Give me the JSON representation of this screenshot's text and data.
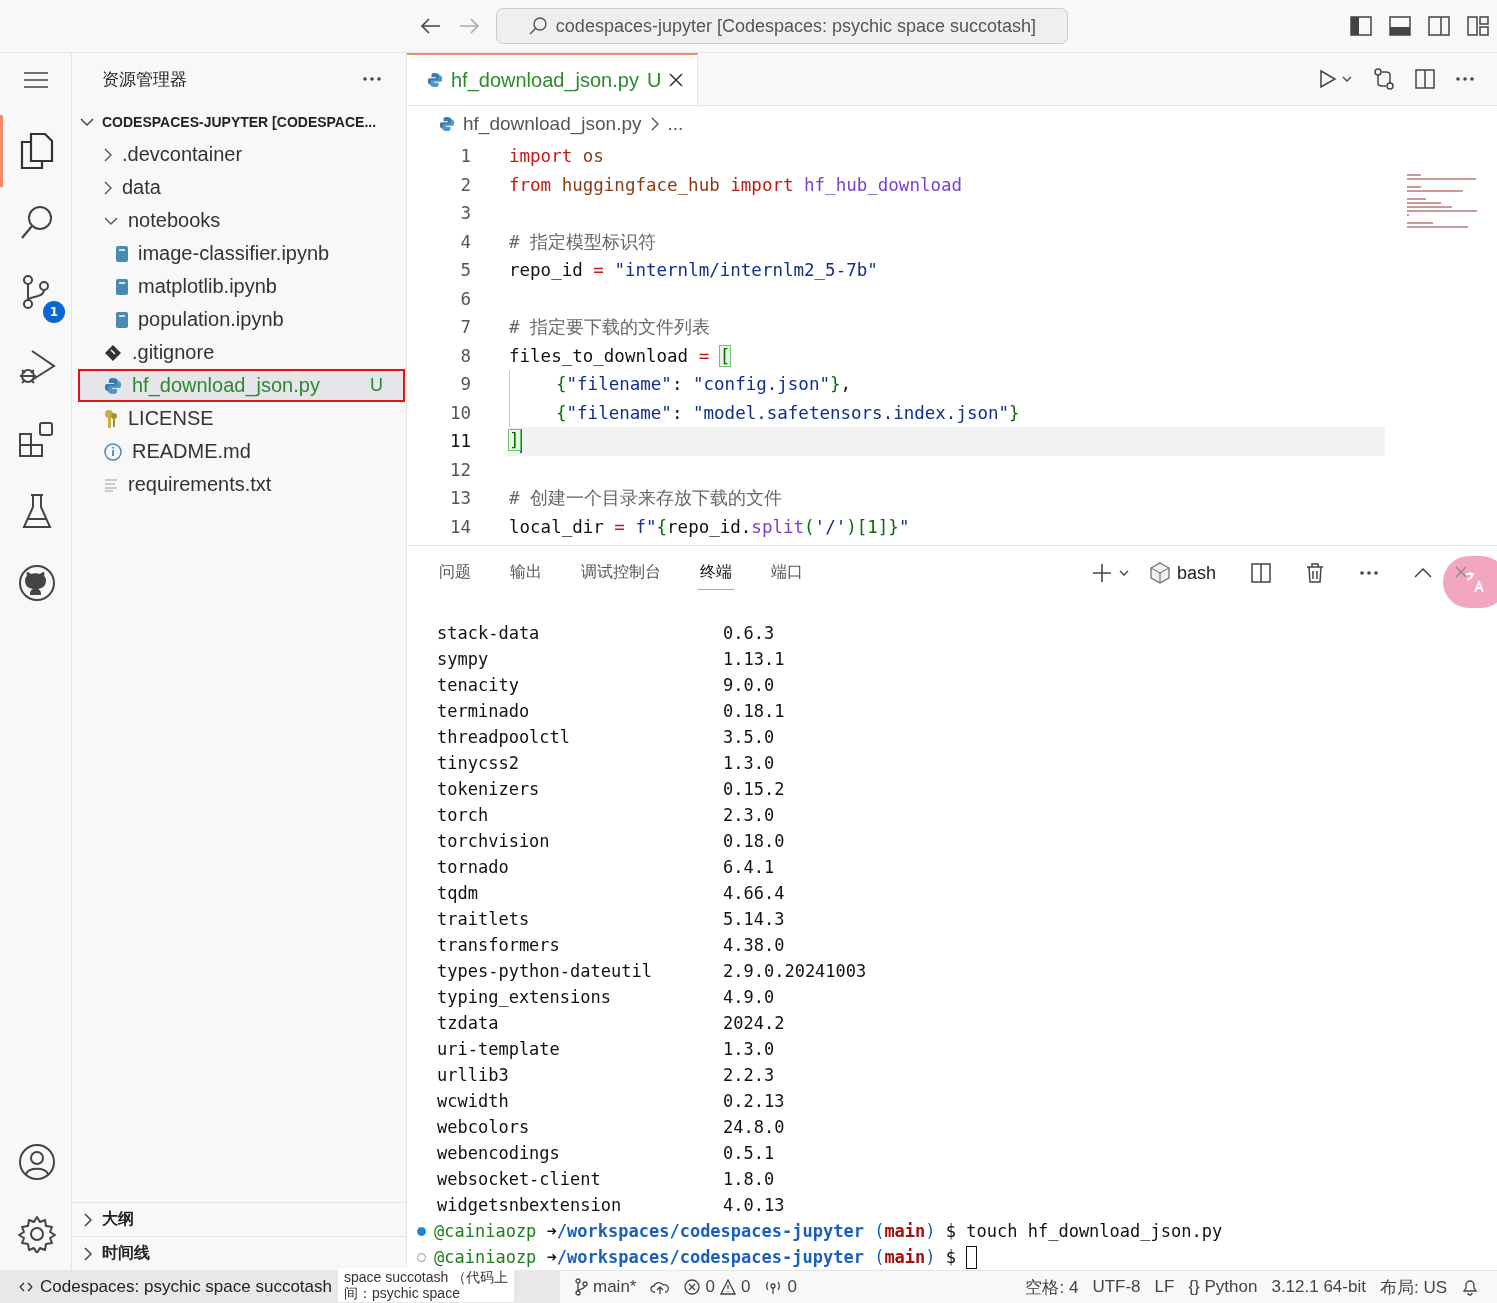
{
  "title_bar": {
    "search": "codespaces-jupyter [Codespaces: psychic space succotash]"
  },
  "activity_bar": {
    "items": [
      {
        "kind": "explorer",
        "selected": true
      },
      {
        "kind": "search",
        "selected": false
      },
      {
        "kind": "source-control",
        "selected": false,
        "badge": "1"
      },
      {
        "kind": "run-debug",
        "selected": false
      },
      {
        "kind": "extensions",
        "selected": false
      },
      {
        "kind": "testing",
        "selected": false
      },
      {
        "kind": "github",
        "selected": false
      }
    ],
    "bottom": [
      {
        "kind": "account"
      },
      {
        "kind": "settings"
      }
    ]
  },
  "sidebar": {
    "title": "资源管理器",
    "root": "CODESPACES-JUPYTER [CODESPACE...",
    "items": [
      {
        "label": ".devcontainer",
        "kind": "folder",
        "expanded": false,
        "selected": false
      },
      {
        "label": "data",
        "kind": "folder",
        "expanded": false,
        "selected": false
      },
      {
        "label": "notebooks",
        "kind": "folder",
        "expanded": true,
        "selected": false,
        "children": [
          {
            "label": "image-classifier.ipynb",
            "kind": "notebook",
            "selected": false
          },
          {
            "label": "matplotlib.ipynb",
            "kind": "notebook",
            "selected": false
          },
          {
            "label": "population.ipynb",
            "kind": "notebook",
            "selected": false
          }
        ]
      },
      {
        "label": ".gitignore",
        "kind": "git",
        "selected": false
      },
      {
        "label": "hf_download_json.py",
        "kind": "python",
        "selected": true,
        "highlighted": true,
        "status": "U"
      },
      {
        "label": "LICENSE",
        "kind": "license",
        "selected": false
      },
      {
        "label": "README.md",
        "kind": "info",
        "selected": false
      },
      {
        "label": "requirements.txt",
        "kind": "text",
        "selected": false
      }
    ],
    "sections": [
      {
        "label": "大纲",
        "expanded": false
      },
      {
        "label": "时间线",
        "expanded": false
      }
    ]
  },
  "editor": {
    "tabs": [
      {
        "label": "hf_download_json.py",
        "status": "U",
        "selected": true
      }
    ],
    "breadcrumb": [
      "hf_download_json.py",
      "..."
    ],
    "lines": [
      {
        "number": "1",
        "current": false,
        "indented": false,
        "tokens": [
          {
            "text": "import",
            "kind": "keyword"
          },
          {
            "text": " os",
            "kind": "module"
          }
        ]
      },
      {
        "number": "2",
        "current": false,
        "indented": false,
        "tokens": [
          {
            "text": "from",
            "kind": "keyword"
          },
          {
            "text": " huggingface_hub ",
            "kind": "module"
          },
          {
            "text": "import",
            "kind": "keyword"
          },
          {
            "text": " hf_hub_download",
            "kind": "function"
          }
        ]
      },
      {
        "number": "3",
        "current": false,
        "indented": false
      },
      {
        "number": "4",
        "current": false,
        "indented": false,
        "tokens": [
          {
            "text": "# 指定模型标识符",
            "kind": "comment"
          }
        ]
      },
      {
        "number": "5",
        "current": false,
        "indented": false,
        "tokens": [
          {
            "text": "repo_id ",
            "kind": "name"
          },
          {
            "text": "=",
            "kind": "operator"
          },
          {
            "text": " \"internlm/internlm2_5-7b\"",
            "kind": "string"
          }
        ]
      },
      {
        "number": "6",
        "current": false,
        "indented": false
      },
      {
        "number": "7",
        "current": false,
        "indented": false,
        "tokens": [
          {
            "text": "# 指定要下载的文件列表",
            "kind": "comment"
          }
        ]
      },
      {
        "number": "8",
        "current": false,
        "indented": false,
        "tokens": [
          {
            "text": "files_to_download ",
            "kind": "name"
          },
          {
            "text": "= ",
            "kind": "operator"
          },
          {
            "text": "[",
            "kind": "matched-bracket"
          }
        ]
      },
      {
        "number": "9",
        "current": false,
        "indented": true,
        "tokens": [
          {
            "text": "{",
            "kind": "bracket"
          },
          {
            "text": "\"filename\"",
            "kind": "string"
          },
          {
            "text": ": ",
            "kind": "name"
          },
          {
            "text": "\"config.json\"",
            "kind": "string"
          },
          {
            "text": "}",
            "kind": "bracket"
          },
          {
            "text": ",",
            "kind": "name"
          }
        ]
      },
      {
        "number": "10",
        "current": false,
        "indented": true,
        "tokens": [
          {
            "text": "{",
            "kind": "bracket"
          },
          {
            "text": "\"filename\"",
            "kind": "string"
          },
          {
            "text": ": ",
            "kind": "name"
          },
          {
            "text": "\"model.safetensors.index.json\"",
            "kind": "string"
          },
          {
            "text": "}",
            "kind": "bracket"
          }
        ]
      },
      {
        "number": "11",
        "current": true,
        "indented": false,
        "tokens": [
          {
            "text": "]",
            "kind": "matched-bracket"
          }
        ]
      },
      {
        "number": "12",
        "current": false,
        "indented": false
      },
      {
        "number": "13",
        "current": false,
        "indented": false,
        "tokens": [
          {
            "text": "# 创建一个目录来存放下载的文件",
            "kind": "comment"
          }
        ]
      },
      {
        "number": "14",
        "current": false,
        "indented": false,
        "tokens": [
          {
            "text": "local_dir ",
            "kind": "name"
          },
          {
            "text": "=",
            "kind": "operator"
          },
          {
            "text": " f\"",
            "kind": "string"
          },
          {
            "text": "{",
            "kind": "bracket"
          },
          {
            "text": "repo_id.",
            "kind": "name"
          },
          {
            "text": "split",
            "kind": "function"
          },
          {
            "text": "(",
            "kind": "bracket"
          },
          {
            "text": "'/'",
            "kind": "string"
          },
          {
            "text": ")[1]",
            "kind": "bracket"
          },
          {
            "text": "}",
            "kind": "bracket"
          },
          {
            "text": "\"",
            "kind": "string"
          }
        ]
      }
    ]
  },
  "panel": {
    "tabs": [
      {
        "label": "问题",
        "selected": false
      },
      {
        "label": "输出",
        "selected": false
      },
      {
        "label": "调试控制台",
        "selected": false
      },
      {
        "label": "终端",
        "selected": true
      },
      {
        "label": "端口",
        "selected": false
      }
    ],
    "shell": "bash",
    "packages": [
      [
        "stack-data",
        "0.6.3"
      ],
      [
        "sympy",
        "1.13.1"
      ],
      [
        "tenacity",
        "9.0.0"
      ],
      [
        "terminado",
        "0.18.1"
      ],
      [
        "threadpoolctl",
        "3.5.0"
      ],
      [
        "tinycss2",
        "1.3.0"
      ],
      [
        "tokenizers",
        "0.15.2"
      ],
      [
        "torch",
        "2.3.0"
      ],
      [
        "torchvision",
        "0.18.0"
      ],
      [
        "tornado",
        "6.4.1"
      ],
      [
        "tqdm",
        "4.66.4"
      ],
      [
        "traitlets",
        "5.14.3"
      ],
      [
        "transformers",
        "4.38.0"
      ],
      [
        "types-python-dateutil",
        "2.9.0.20241003"
      ],
      [
        "typing_extensions",
        "4.9.0"
      ],
      [
        "tzdata",
        "2024.2"
      ],
      [
        "uri-template",
        "1.3.0"
      ],
      [
        "urllib3",
        "2.2.3"
      ],
      [
        "wcwidth",
        "0.2.13"
      ],
      [
        "webcolors",
        "24.8.0"
      ],
      [
        "webencodings",
        "0.5.1"
      ],
      [
        "websocket-client",
        "1.8.0"
      ],
      [
        "widgetsnbextension",
        "4.0.13"
      ]
    ],
    "prompts": [
      {
        "done": true,
        "parts": [
          {
            "text": "@cainiaozp ",
            "kind": "user"
          },
          {
            "text": "➜",
            "kind": "arrow"
          },
          {
            "text": "/workspaces/codespaces-jupyter ",
            "kind": "path"
          },
          {
            "text": "(",
            "kind": "paren"
          },
          {
            "text": "main",
            "kind": "branch"
          },
          {
            "text": ") ",
            "kind": "paren"
          },
          {
            "text": "$ ",
            "kind": "symbol"
          },
          {
            "text": "touch hf_download_json.py",
            "kind": "command"
          }
        ]
      },
      {
        "done": false,
        "parts": [
          {
            "text": "@cainiaozp ",
            "kind": "user"
          },
          {
            "text": "➜",
            "kind": "arrow"
          },
          {
            "text": "/workspaces/codespaces-jupyter ",
            "kind": "path"
          },
          {
            "text": "(",
            "kind": "paren"
          },
          {
            "text": "main",
            "kind": "branch"
          },
          {
            "text": ") ",
            "kind": "paren"
          },
          {
            "text": "$ ",
            "kind": "symbol"
          }
        ]
      }
    ]
  },
  "tooltip": [
    "space succotash （代码上",
    "间：psychic space"
  ],
  "status_bar": {
    "remote": "Codespaces: psychic space succotash",
    "branch": "main*",
    "errors": "0",
    "warnings": "0",
    "ports": "0",
    "right": [
      "空格: 4",
      "UTF-8",
      "LF",
      "{} Python",
      "3.12.1 64-bit",
      "布局: US"
    ]
  }
}
